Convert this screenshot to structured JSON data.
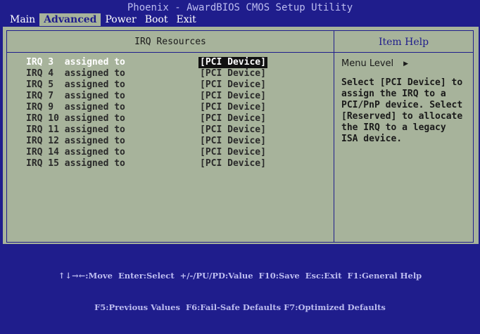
{
  "title": "Phoenix - AwardBIOS CMOS Setup Utility",
  "menu": [
    {
      "label": "Main",
      "active": false
    },
    {
      "label": "Advanced",
      "active": true
    },
    {
      "label": "Power",
      "active": false
    },
    {
      "label": "Boot",
      "active": false
    },
    {
      "label": "Exit",
      "active": false
    }
  ],
  "panel_title": "IRQ Resources",
  "help_title": "Item Help",
  "irqs": [
    {
      "label": "IRQ 3  assigned to",
      "value": "[PCI Device]"
    },
    {
      "label": "IRQ 4  assigned to",
      "value": "[PCI Device]"
    },
    {
      "label": "IRQ 5  assigned to",
      "value": "[PCI Device]"
    },
    {
      "label": "IRQ 7  assigned to",
      "value": "[PCI Device]"
    },
    {
      "label": "IRQ 9  assigned to",
      "value": "[PCI Device]"
    },
    {
      "label": "IRQ 10 assigned to",
      "value": "[PCI Device]"
    },
    {
      "label": "IRQ 11 assigned to",
      "value": "[PCI Device]"
    },
    {
      "label": "IRQ 12 assigned to",
      "value": "[PCI Device]"
    },
    {
      "label": "IRQ 14 assigned to",
      "value": "[PCI Device]"
    },
    {
      "label": "IRQ 15 assigned to",
      "value": "[PCI Device]"
    }
  ],
  "help": {
    "menu_level": "Menu Level",
    "text": "Select [PCI Device] to\nassign the IRQ to a\nPCI/PnP device. Select\n[Reserved] to allocate\nthe IRQ to a legacy\nISA device."
  },
  "status": {
    "line1": "↑↓→←:Move  Enter:Select  +/-/PU/PD:Value  F10:Save  Esc:Exit  F1:General Help",
    "line2": "F5:Previous Values  F6:Fail-Safe Defaults F7:Optimized Defaults"
  },
  "colors": {
    "background": "#1f1d8c",
    "panel": "#a7b39b",
    "selected_value_bg": "#111111",
    "text_light": "#ffffff"
  }
}
